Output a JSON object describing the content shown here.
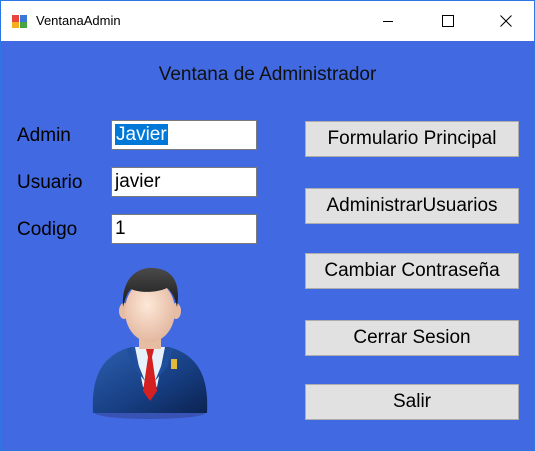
{
  "window": {
    "title": "VentanaAdmin",
    "app_icon": "forms-app-icon",
    "controls": [
      "minimize-icon",
      "maximize-icon",
      "close-icon"
    ]
  },
  "heading": "Ventana de Administrador",
  "fields": {
    "admin": {
      "label": "Admin",
      "value": "Javier",
      "selected": true
    },
    "usuario": {
      "label": "Usuario",
      "value": "javier"
    },
    "codigo": {
      "label": "Codigo",
      "value": "1"
    }
  },
  "buttons": {
    "formulario": "Formulario Principal",
    "administrar": "AdministrarUsuarios",
    "cambiar": "Cambiar Contraseña",
    "cerrar": "Cerrar Sesion",
    "salir": "Salir"
  },
  "avatar_icon": "admin-user-avatar",
  "colors": {
    "form_background": "#4169e1",
    "button_background": "#e1e1e1",
    "selection": "#0078d7"
  }
}
